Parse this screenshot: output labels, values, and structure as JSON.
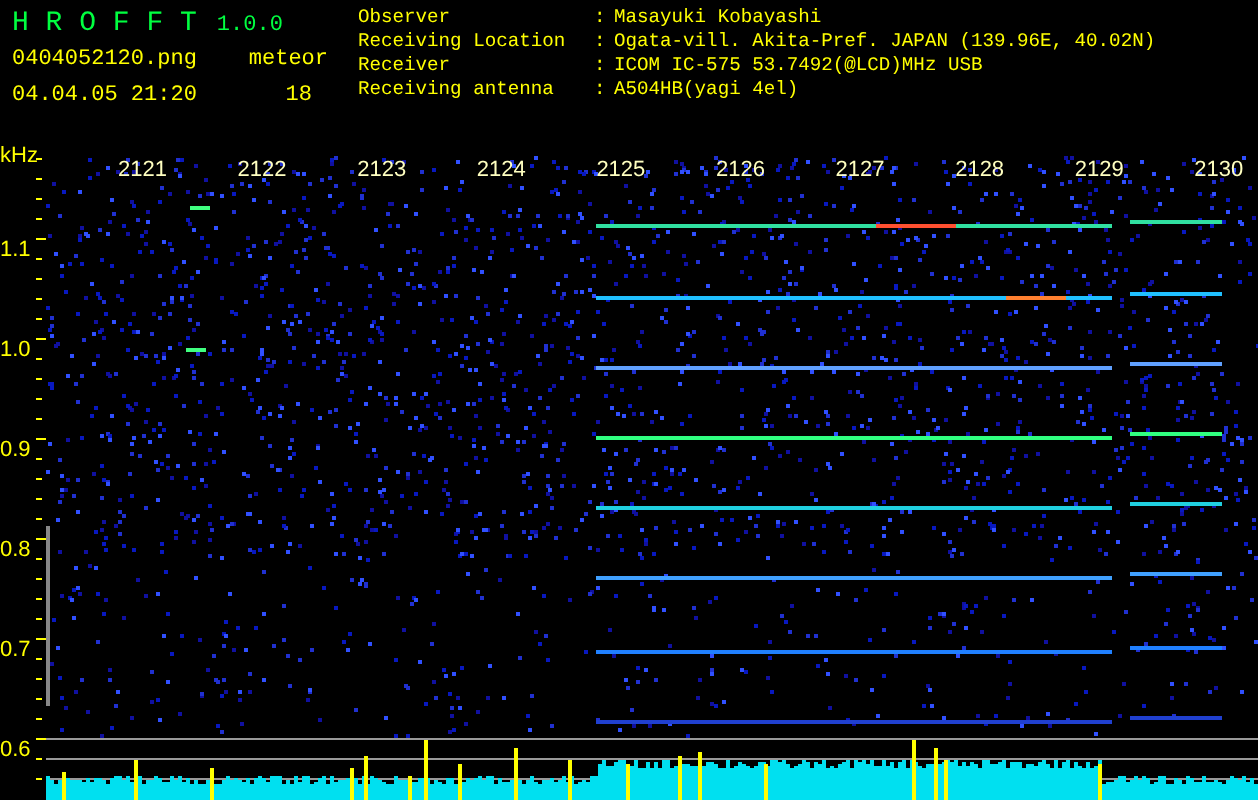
{
  "app": {
    "name": "H R O F F T",
    "version": "1.0.0"
  },
  "file": "0404052120.png",
  "meteor_label": "meteor",
  "datetime": "04.04.05 21:20",
  "meteor_count": "18",
  "info": [
    {
      "label": "Observer",
      "separator": ":",
      "value": "Masayuki Kobayashi"
    },
    {
      "label": "Receiving Location",
      "separator": ":",
      "value": "Ogata-vill. Akita-Pref. JAPAN (139.96E, 40.02N)"
    },
    {
      "label": "Receiver",
      "separator": ":",
      "value": "ICOM IC-575 53.7492(@LCD)MHz USB"
    },
    {
      "label": "Receiving antenna",
      "separator": ":",
      "value": "A504HB(yagi 4el)"
    }
  ],
  "axis": {
    "unit": "kHz",
    "y_labels": [
      "1.1",
      "1.0",
      "0.9",
      "0.8",
      "0.7",
      "0.6"
    ],
    "x_labels": [
      "2121",
      "2122",
      "2123",
      "2124",
      "2125",
      "2126",
      "2127",
      "2128",
      "2129",
      "2130"
    ]
  }
}
